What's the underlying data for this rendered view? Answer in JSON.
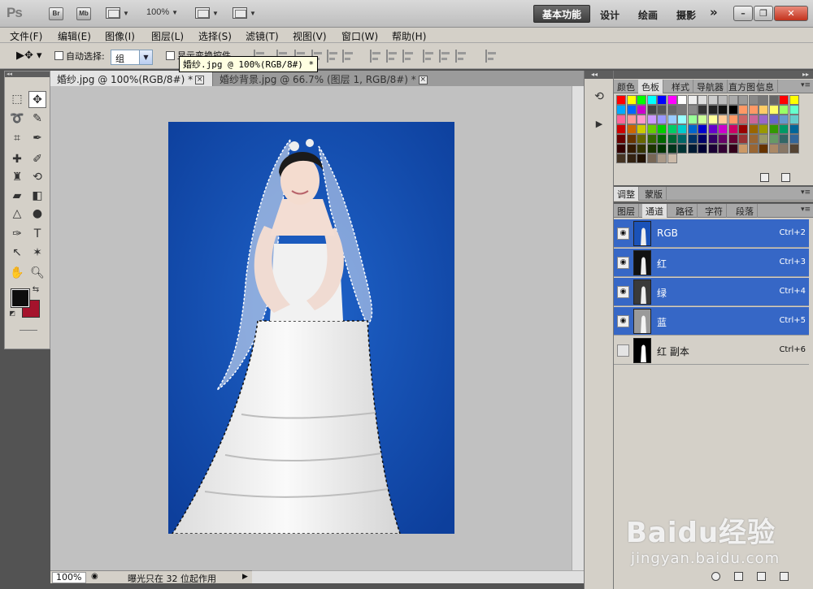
{
  "app": {
    "logo": "Ps",
    "launch_bridge": "Br",
    "launch_mini": "Mb",
    "zoom_dropdown": "100%",
    "workspaces": {
      "active": "基本功能",
      "design": "设计",
      "painting": "绘画",
      "photography": "摄影",
      "more": "»"
    }
  },
  "menu": [
    "文件(F)",
    "编辑(E)",
    "图像(I)",
    "图层(L)",
    "选择(S)",
    "滤镜(T)",
    "视图(V)",
    "窗口(W)",
    "帮助(H)"
  ],
  "options": {
    "auto_select_label": "自动选择:",
    "auto_select_value": "组",
    "show_transform_label": "显示变换控件",
    "tooltip": "婚纱.jpg @ 100%(RGB/8#) *"
  },
  "tabs": [
    {
      "label": "婚纱.jpg @ 100%(RGB/8#) *",
      "active": true
    },
    {
      "label": "婚纱背景.jpg @ 66.7% (图层 1, RGB/8#) *",
      "active": false
    }
  ],
  "status": {
    "zoom": "100%",
    "info": "曝光只在 32 位起作用"
  },
  "panels": {
    "top_tabs": [
      "颜色",
      "色板",
      "样式",
      "导航器",
      "直方图",
      "信息"
    ],
    "top_active": "色板",
    "mid_tabs": [
      "调整",
      "蒙版"
    ],
    "mid_active": "调整",
    "bottom_tabs": [
      "图层",
      "通道",
      "路径",
      "字符",
      "段落"
    ],
    "bottom_active": "通道"
  },
  "channels": [
    {
      "name": "RGB",
      "shortcut": "Ctrl+2",
      "selected": true,
      "visible": true
    },
    {
      "name": "红",
      "shortcut": "Ctrl+3",
      "selected": true,
      "visible": true
    },
    {
      "name": "绿",
      "shortcut": "Ctrl+4",
      "selected": true,
      "visible": true
    },
    {
      "name": "蓝",
      "shortcut": "Ctrl+5",
      "selected": true,
      "visible": true
    },
    {
      "name": "红 副本",
      "shortcut": "Ctrl+6",
      "selected": false,
      "visible": false
    }
  ],
  "colors": {
    "foreground": "#0d0d0d",
    "background": "#a5132c",
    "photo_backdrop": "#1550b4",
    "selected_row": "#3667c6"
  },
  "watermark": {
    "brand": "Baidu经验",
    "url": "jingyan.baidu.com"
  }
}
